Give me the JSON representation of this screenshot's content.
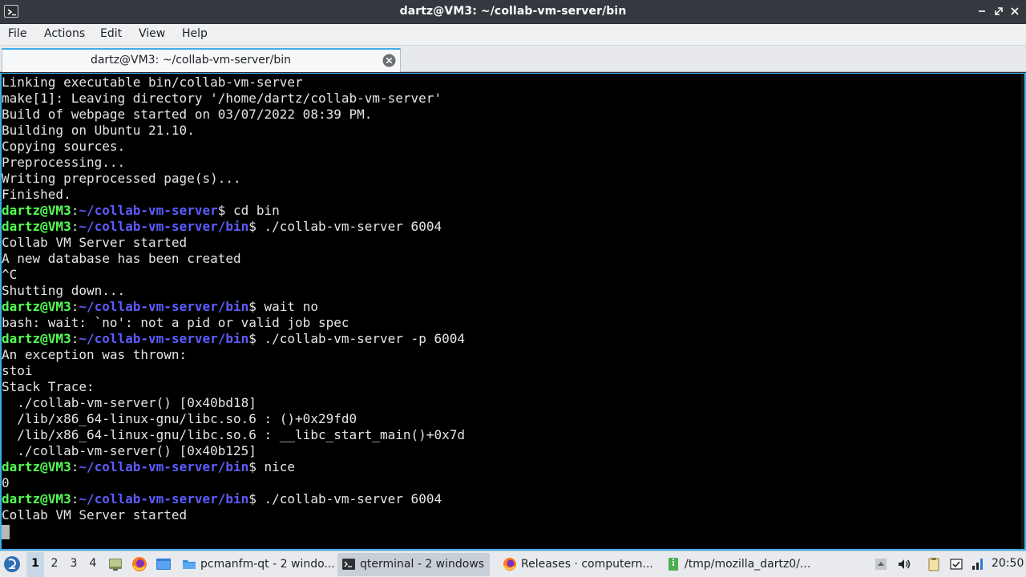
{
  "window": {
    "title": "dartz@VM3: ~/collab-vm-server/bin"
  },
  "menu": {
    "items": [
      "File",
      "Actions",
      "Edit",
      "View",
      "Help"
    ]
  },
  "tab": {
    "label": "dartz@VM3: ~/collab-vm-server/bin"
  },
  "terminal": {
    "colors": {
      "background": "#000000",
      "text": "#e5e5e5",
      "prompt_user": "#54ff54",
      "prompt_path": "#5c5cff",
      "focus_border": "#3daee9"
    },
    "lines": [
      {
        "text": "Linking executable bin/collab-vm-server"
      },
      {
        "text": "make[1]: Leaving directory '/home/dartz/collab-vm-server'"
      },
      {
        "text": "Build of webpage started on 03/07/2022 08:39 PM."
      },
      {
        "text": "Building on Ubuntu 21.10."
      },
      {
        "text": "Copying sources."
      },
      {
        "text": "Preprocessing..."
      },
      {
        "text": "Writing preprocessed page(s)..."
      },
      {
        "text": "Finished."
      },
      {
        "user": "dartz@VM3",
        "path": "~/collab-vm-server",
        "cmd": "$ cd bin"
      },
      {
        "user": "dartz@VM3",
        "path": "~/collab-vm-server/bin",
        "cmd": "$ ./collab-vm-server 6004"
      },
      {
        "text": "Collab VM Server started"
      },
      {
        "text": "A new database has been created"
      },
      {
        "text": "^C"
      },
      {
        "text": "Shutting down..."
      },
      {
        "user": "dartz@VM3",
        "path": "~/collab-vm-server/bin",
        "cmd": "$ wait no"
      },
      {
        "text": "bash: wait: `no': not a pid or valid job spec"
      },
      {
        "user": "dartz@VM3",
        "path": "~/collab-vm-server/bin",
        "cmd": "$ ./collab-vm-server -p 6004"
      },
      {
        "text": "An exception was thrown:"
      },
      {
        "text": "stoi"
      },
      {
        "text": "Stack Trace:"
      },
      {
        "text": "  ./collab-vm-server() [0x40bd18]"
      },
      {
        "text": "  /lib/x86_64-linux-gnu/libc.so.6 : ()+0x29fd0"
      },
      {
        "text": "  /lib/x86_64-linux-gnu/libc.so.6 : __libc_start_main()+0x7d"
      },
      {
        "text": "  ./collab-vm-server() [0x40b125]"
      },
      {
        "user": "dartz@VM3",
        "path": "~/collab-vm-server/bin",
        "cmd": "$ nice"
      },
      {
        "text": "0"
      },
      {
        "user": "dartz@VM3",
        "path": "~/collab-vm-server/bin",
        "cmd": "$ ./collab-vm-server 6004"
      },
      {
        "text": "Collab VM Server started"
      },
      {
        "cursor": true
      }
    ]
  },
  "taskbar": {
    "desktops": [
      "1",
      "2",
      "3",
      "4"
    ],
    "active_desktop": "1",
    "quicklaunch": [
      "show-desktop-icon",
      "firefox-icon",
      "file-manager-icon"
    ],
    "tasks": [
      {
        "label": "pcmanfm-qt - 2 windo...",
        "icon": "folder-icon",
        "active": false
      },
      {
        "label": "qterminal - 2 windows",
        "icon": "terminal-icon",
        "active": true
      },
      {
        "label": "Releases · computern...",
        "icon": "firefox-icon",
        "active": false
      },
      {
        "label": "/tmp/mozilla_dartz0/...",
        "icon": "archive-icon",
        "active": false
      }
    ],
    "tray": [
      "tray-arrow-icon",
      "volume-icon",
      "clipboard-icon",
      "updates-icon",
      "network-icon"
    ],
    "clock": "20:50"
  }
}
